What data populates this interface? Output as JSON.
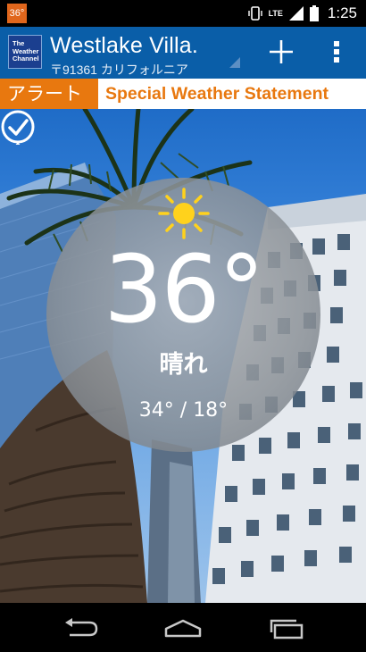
{
  "status_bar": {
    "notification_temp": "36°",
    "network": "LTE",
    "time": "1:25",
    "icons": [
      "vibrate-icon",
      "signal-icon",
      "battery-icon"
    ]
  },
  "action_bar": {
    "logo_text": "The Weather Channel",
    "location_name": "Westlake Villa.",
    "location_sub": "〒91361 カリフォルニア",
    "add_icon": "plus-icon",
    "menu_icon": "overflow-menu-icon",
    "color": "#0a5ea8"
  },
  "alert": {
    "tag": "アラート",
    "text": "Special Weather Statement",
    "color": "#e8780f"
  },
  "weather": {
    "temperature": "36°",
    "condition": "晴れ",
    "range": "34° / 18°",
    "condition_icon": "sun-icon",
    "check_icon": "check-circle-icon"
  },
  "nav_bar": {
    "icons": [
      "back-icon",
      "home-icon",
      "recent-apps-icon"
    ]
  }
}
